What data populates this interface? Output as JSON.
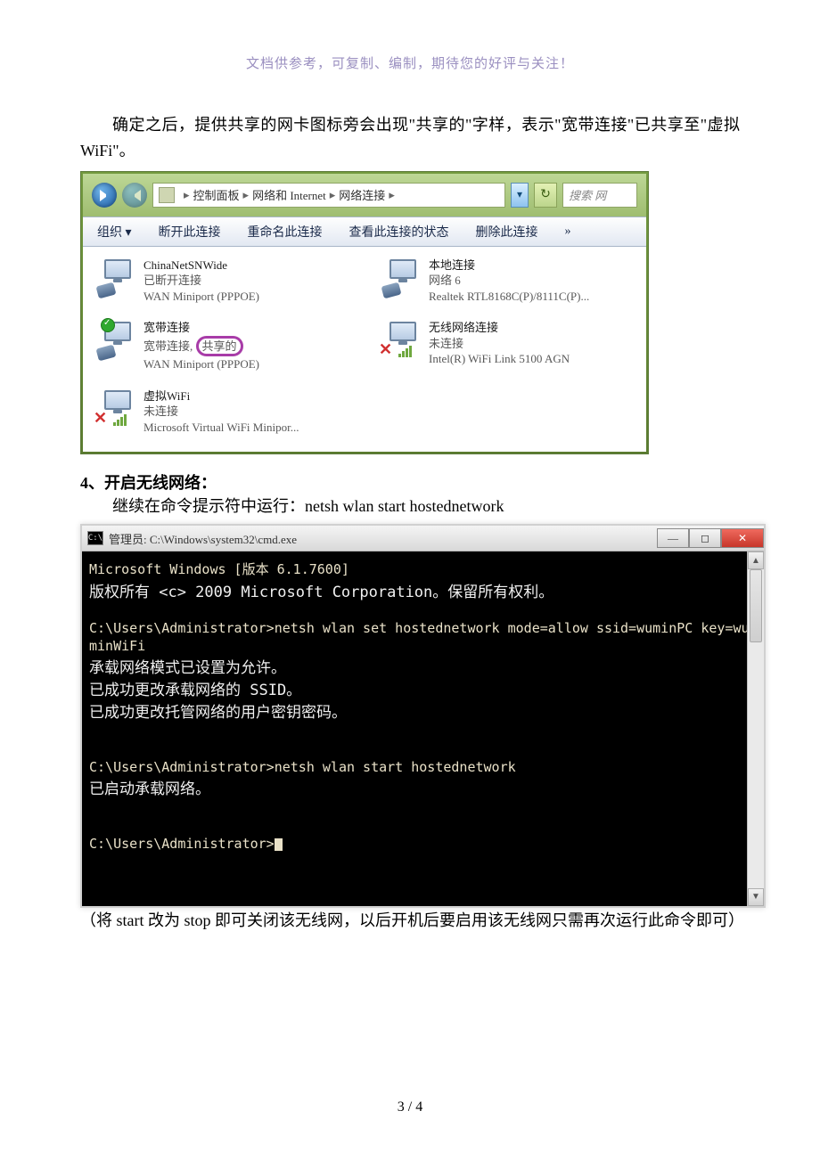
{
  "header_note": "文档供参考，可复制、编制，期待您的好评与关注！",
  "para1": "确定之后，提供共享的网卡图标旁会出现\"共享的\"字样，表示\"宽带连接\"已共享至\"虚拟 WiFi\"。",
  "explorer": {
    "breadcrumbs": [
      "控制面板",
      "网络和 Internet",
      "网络连接"
    ],
    "search_placeholder": "搜索 网",
    "toolbar": {
      "organize": "组织 ▾",
      "disconnect": "断开此连接",
      "rename": "重命名此连接",
      "status": "查看此连接的状态",
      "delete": "删除此连接",
      "more": "»"
    },
    "conns": {
      "chinanet": {
        "title": "ChinaNetSNWide",
        "line2": "已断开连接",
        "line3": "WAN Miniport (PPPOE)"
      },
      "local": {
        "title": "本地连接",
        "line2": "网络  6",
        "line3": "Realtek RTL8168C(P)/8111C(P)..."
      },
      "broadband": {
        "title": "宽带连接",
        "line2a": "宽带连接",
        "shared": "共享的",
        "line3": "WAN Miniport (PPPOE)"
      },
      "wifi": {
        "title": "无线网络连接",
        "line2": "未连接",
        "line3": "Intel(R) WiFi Link 5100 AGN"
      },
      "virtual": {
        "title": "虚拟WiFi",
        "line2": "未连接",
        "line3": "Microsoft Virtual WiFi Minipor..."
      }
    }
  },
  "section4": {
    "heading_num": "4、",
    "heading_text": "开启无线网络：",
    "line": "继续在命令提示符中运行：netsh wlan start hostednetwork"
  },
  "cmd": {
    "title": "管理员: C:\\Windows\\system32\\cmd.exe",
    "l1": "Microsoft Windows [版本 6.1.7600]",
    "l2": "版权所有 <c> 2009 Microsoft Corporation。保留所有权利。",
    "l3": "C:\\Users\\Administrator>netsh wlan set hostednetwork mode=allow ssid=wuminPC key=wuminWiFi",
    "l4": "承载网络模式已设置为允许。",
    "l5": "已成功更改承载网络的 SSID。",
    "l6": "已成功更改托管网络的用户密钥密码。",
    "l7": "C:\\Users\\Administrator>netsh wlan start hostednetwork",
    "l8": "已启动承载网络。",
    "l9": "C:\\Users\\Administrator>"
  },
  "para_after_cmd": "（将 start 改为 stop 即可关闭该无线网，以后开机后要启用该无线网只需再次运行此命令即可）",
  "page_number": "3 / 4"
}
